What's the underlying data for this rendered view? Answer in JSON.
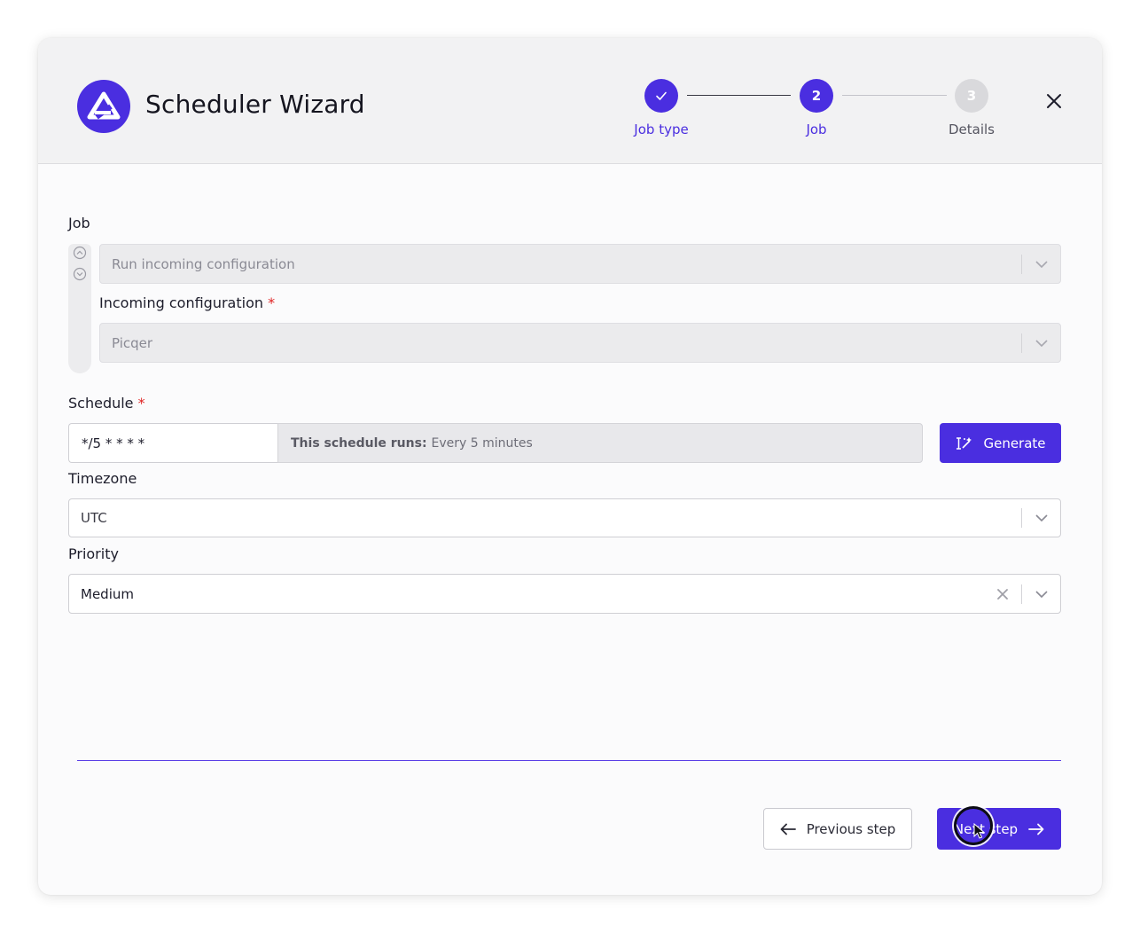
{
  "header": {
    "title": "Scheduler Wizard",
    "steps": [
      {
        "label": "Job type",
        "number": "",
        "state": "done"
      },
      {
        "label": "Job",
        "number": "2",
        "state": "active"
      },
      {
        "label": "Details",
        "number": "3",
        "state": "todo"
      }
    ]
  },
  "job": {
    "label": "Job",
    "job_select_value": "Run incoming configuration",
    "incoming_label": "Incoming configuration",
    "incoming_required": "*",
    "incoming_value": "Picqer"
  },
  "schedule": {
    "label": "Schedule",
    "required": "*",
    "cron_value": "*/5 * * * *",
    "description_prefix": "This schedule runs:",
    "description_value": "Every 5 minutes",
    "generate_label": "Generate"
  },
  "timezone": {
    "label": "Timezone",
    "value": "UTC"
  },
  "priority": {
    "label": "Priority",
    "value": "Medium"
  },
  "footer": {
    "previous_label": "Previous step",
    "next_label": "Next step"
  },
  "colors": {
    "accent": "#4a2ee0",
    "required": "#e02424",
    "inactive_step": "#d9d9dc"
  }
}
